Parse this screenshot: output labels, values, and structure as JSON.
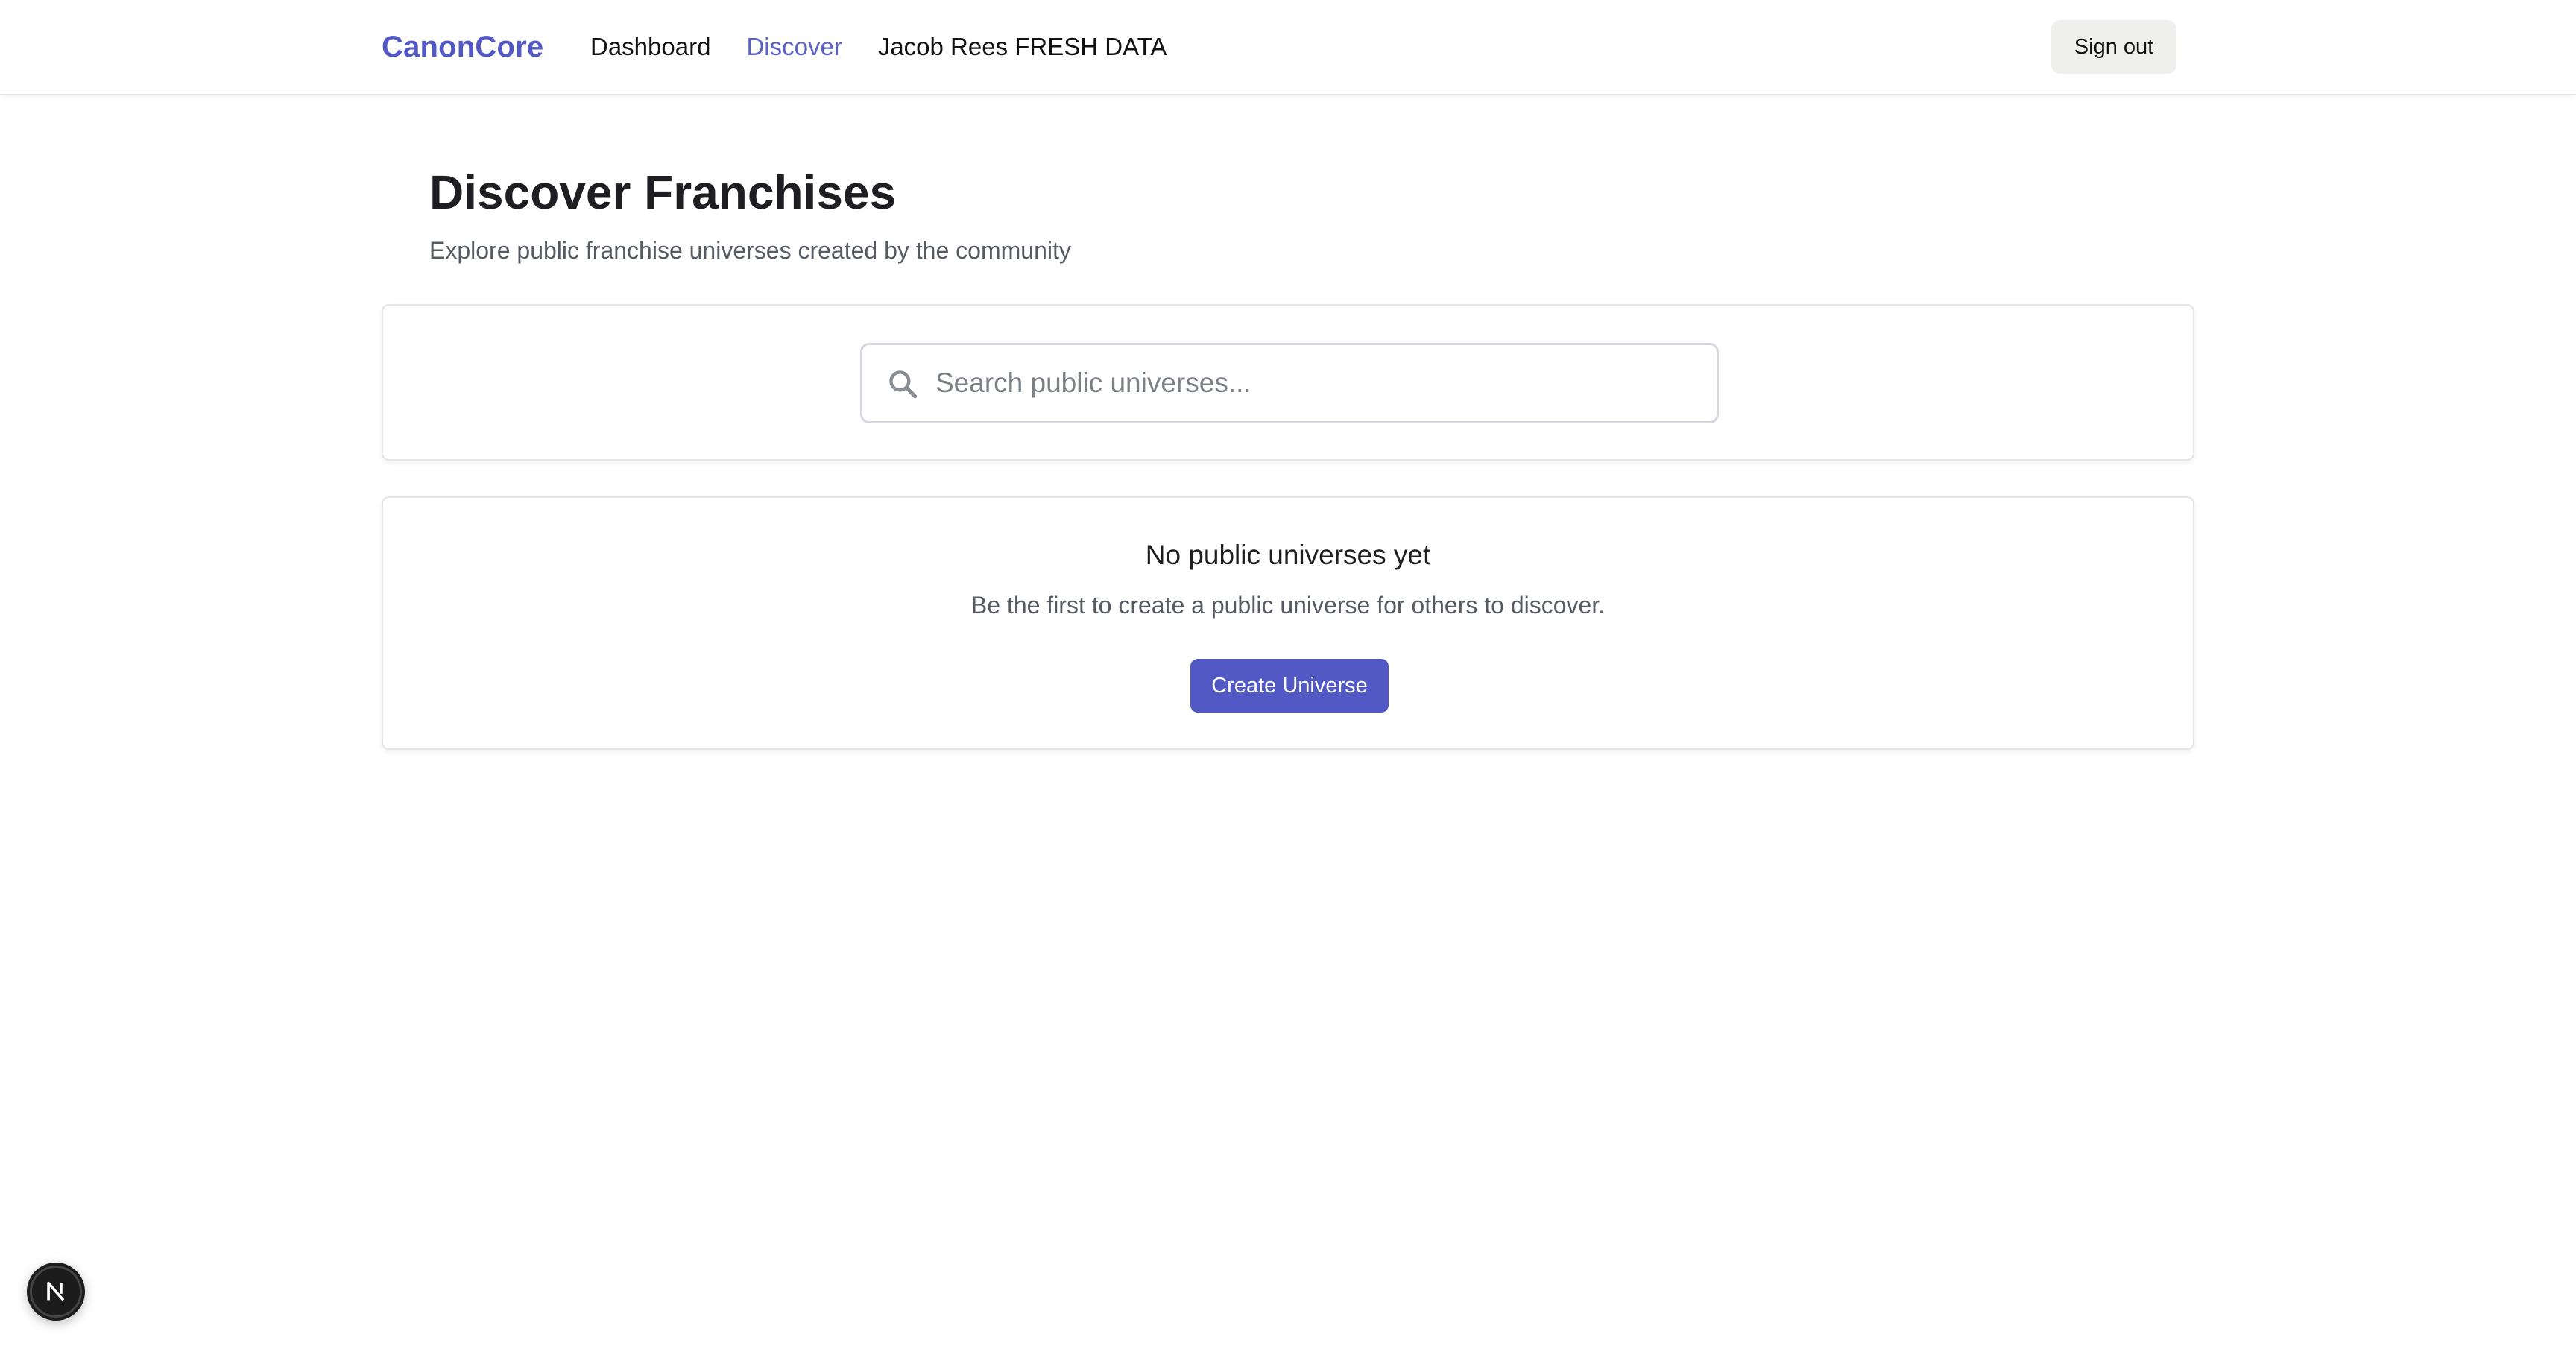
{
  "header": {
    "brand": "CanonCore",
    "nav": [
      {
        "label": "Dashboard",
        "active": false
      },
      {
        "label": "Discover",
        "active": true
      },
      {
        "label": "Jacob Rees FRESH DATA",
        "active": false
      }
    ],
    "sign_out_label": "Sign out"
  },
  "page": {
    "title": "Discover Franchises",
    "subtitle": "Explore public franchise universes created by the community"
  },
  "search": {
    "placeholder": "Search public universes...",
    "value": "",
    "icon": "search-icon"
  },
  "empty_state": {
    "title": "No public universes yet",
    "text": "Be the first to create a public universe for others to discover.",
    "button_label": "Create Universe"
  },
  "devtools": {
    "icon": "nextjs-devtools-icon"
  },
  "colors": {
    "brand": "#5259c4",
    "active_nav": "#5a62c6",
    "button_bg": "#5259c4",
    "signout_bg": "#efefed"
  }
}
